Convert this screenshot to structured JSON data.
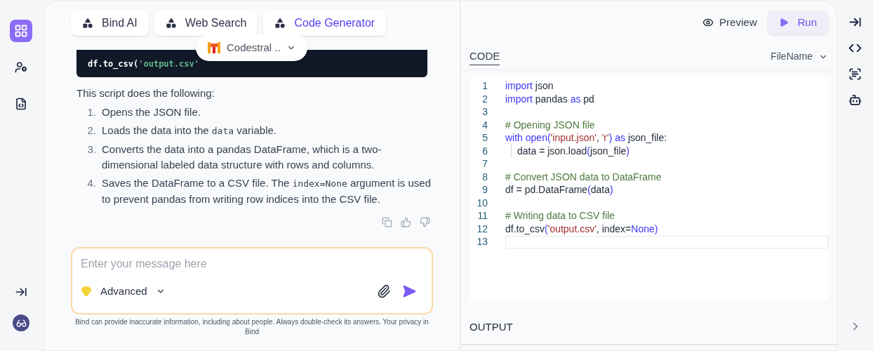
{
  "left_sidebar": {
    "items": [
      {
        "kind": "grid",
        "selected": true
      },
      {
        "kind": "user-settings",
        "selected": false
      },
      {
        "kind": "code-file",
        "selected": false
      }
    ],
    "bottom_items": [
      {
        "kind": "collapse"
      },
      {
        "kind": "incognito"
      }
    ]
  },
  "chat": {
    "tabs": [
      {
        "label": "Bind AI",
        "selected": false
      },
      {
        "label": "Web Search",
        "selected": false
      },
      {
        "label": "Code Generator",
        "selected": true
      }
    ],
    "model_picker": {
      "label": "Codestral .."
    },
    "code_snippet": [
      {
        "text": "df.to_csv(",
        "kind": "plain"
      },
      {
        "text": "'output.csv'",
        "kind": "string"
      }
    ],
    "intro": "This script does the following:",
    "steps": [
      {
        "number": "1.",
        "segments": [
          {
            "text": "Opens the JSON file.",
            "kind": "text"
          }
        ]
      },
      {
        "number": "2.",
        "segments": [
          {
            "text": "Loads the data into the ",
            "kind": "text"
          },
          {
            "text": "data",
            "kind": "code"
          },
          {
            "text": " variable.",
            "kind": "text"
          }
        ]
      },
      {
        "number": "3.",
        "segments": [
          {
            "text": "Converts the data into a pandas DataFrame, which is a two-dimensional labeled data structure with rows and columns.",
            "kind": "text"
          }
        ]
      },
      {
        "number": "4.",
        "segments": [
          {
            "text": "Saves the DataFrame to a CSV file. The ",
            "kind": "text"
          },
          {
            "text": "index=None",
            "kind": "code"
          },
          {
            "text": " argument is used to prevent pandas from writing row indices into the CSV file.",
            "kind": "text"
          }
        ]
      }
    ],
    "composer": {
      "placeholder": "Enter your message here",
      "mode": "Advanced"
    },
    "disclaimer": "Bind can provide inaccurate information, including about people. Always double-check its answers. Your privacy in Bind"
  },
  "editor": {
    "preview_label": "Preview",
    "run_label": "Run",
    "code_tab": "CODE",
    "file_select": "FileName",
    "lines": [
      {
        "number": "1",
        "indent": false,
        "current": false,
        "tokens": [
          {
            "text": "import",
            "kind": "keyword"
          },
          {
            "text": " json",
            "kind": "plain"
          }
        ]
      },
      {
        "number": "2",
        "indent": false,
        "current": false,
        "tokens": [
          {
            "text": "import",
            "kind": "keyword"
          },
          {
            "text": " pandas ",
            "kind": "plain"
          },
          {
            "text": "as",
            "kind": "keyword"
          },
          {
            "text": " pd",
            "kind": "plain"
          }
        ]
      },
      {
        "number": "3",
        "indent": false,
        "current": false
      },
      {
        "number": "4",
        "indent": false,
        "current": false,
        "tokens": [
          {
            "text": "# Opening JSON file",
            "kind": "comment"
          }
        ]
      },
      {
        "number": "5",
        "indent": false,
        "current": false,
        "tokens": [
          {
            "text": "with open(",
            "kind": "keyword"
          },
          {
            "text": "'input.json'",
            "kind": "string"
          },
          {
            "text": ", ",
            "kind": "plain"
          },
          {
            "text": "'r'",
            "kind": "string"
          },
          {
            "text": ") as",
            "kind": "keyword"
          },
          {
            "text": " json_file:",
            "kind": "plain"
          }
        ]
      },
      {
        "number": "6",
        "indent": true,
        "current": false,
        "tokens": [
          {
            "text": "data = json.load",
            "kind": "plain"
          },
          {
            "text": "(",
            "kind": "keyword"
          },
          {
            "text": "json_file",
            "kind": "plain"
          },
          {
            "text": ")",
            "kind": "keyword"
          }
        ]
      },
      {
        "number": "7",
        "indent": false,
        "current": false
      },
      {
        "number": "8",
        "indent": false,
        "current": false,
        "tokens": [
          {
            "text": "# Convert JSON data to DataFrame",
            "kind": "comment"
          }
        ]
      },
      {
        "number": "9",
        "indent": false,
        "current": false,
        "tokens": [
          {
            "text": "df = pd.DataFrame",
            "kind": "plain"
          },
          {
            "text": "(",
            "kind": "keyword"
          },
          {
            "text": "data",
            "kind": "plain"
          },
          {
            "text": ")",
            "kind": "keyword"
          }
        ]
      },
      {
        "number": "10",
        "indent": false,
        "current": false
      },
      {
        "number": "11",
        "indent": false,
        "current": false,
        "tokens": [
          {
            "text": "# Writing data to CSV file",
            "kind": "comment"
          }
        ]
      },
      {
        "number": "12",
        "indent": false,
        "current": false,
        "tokens": [
          {
            "text": "df.to_csv",
            "kind": "plain"
          },
          {
            "text": "(",
            "kind": "keyword"
          },
          {
            "text": "'output.csv'",
            "kind": "string"
          },
          {
            "text": ", index=",
            "kind": "plain"
          },
          {
            "text": "None",
            "kind": "keyword"
          },
          {
            "text": ")",
            "kind": "keyword"
          }
        ]
      },
      {
        "number": "13",
        "indent": false,
        "current": true
      }
    ],
    "output_label": "OUTPUT"
  },
  "right_sidebar": {
    "items": [
      {
        "kind": "collapse"
      },
      {
        "kind": "code"
      },
      {
        "kind": "scan"
      },
      {
        "kind": "bot"
      }
    ]
  }
}
